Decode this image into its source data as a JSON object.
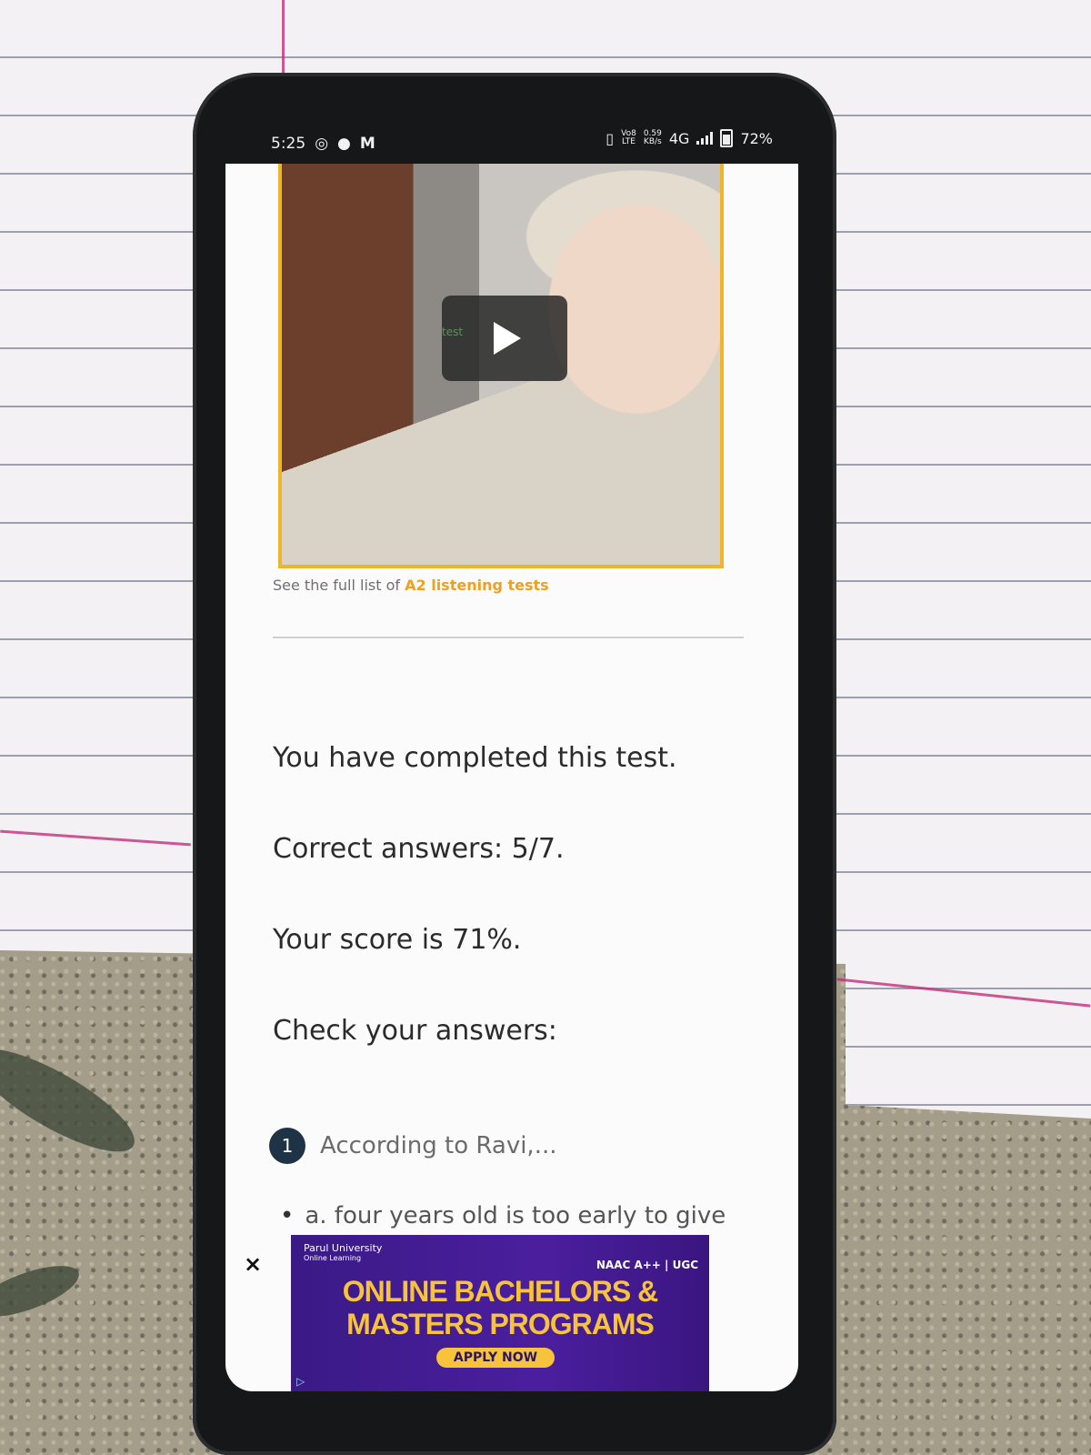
{
  "status_bar": {
    "time": "5:25",
    "left_icons": [
      "whatsapp-icon",
      "location-icon",
      "gmail-icon"
    ],
    "volte_top": "Vo8",
    "volte_bottom": "LTE",
    "speed_top": "0.59",
    "speed_bottom": "KB/s",
    "network": "4G",
    "battery": "72%"
  },
  "video": {
    "watermark": "test",
    "play_icon": "play-icon"
  },
  "caption": {
    "prefix": "See the full list of ",
    "link": "A2 listening tests"
  },
  "results": {
    "completed": "You have completed this test.",
    "correct": "Correct answers: 5/7.",
    "score": "Your score is 71%.",
    "check": "Check your answers:"
  },
  "questions": [
    {
      "number": "1",
      "prompt": "According to Ravi,...",
      "option_a": "a. four years old is too early to give"
    }
  ],
  "ad": {
    "close_label": "×",
    "brand": "Parul University",
    "brand_sub": "Online Learning",
    "badges": "NAAC A++ | UGC",
    "title_line1": "ONLINE BACHELORS &",
    "title_line2": "MASTERS PROGRAMS",
    "cta": "APPLY NOW",
    "colors": {
      "background": "#4b1e9e",
      "accent": "#f6c33a"
    }
  },
  "colors": {
    "accent": "#f0b429",
    "link": "#f0a020",
    "badge": "#1f3347"
  }
}
